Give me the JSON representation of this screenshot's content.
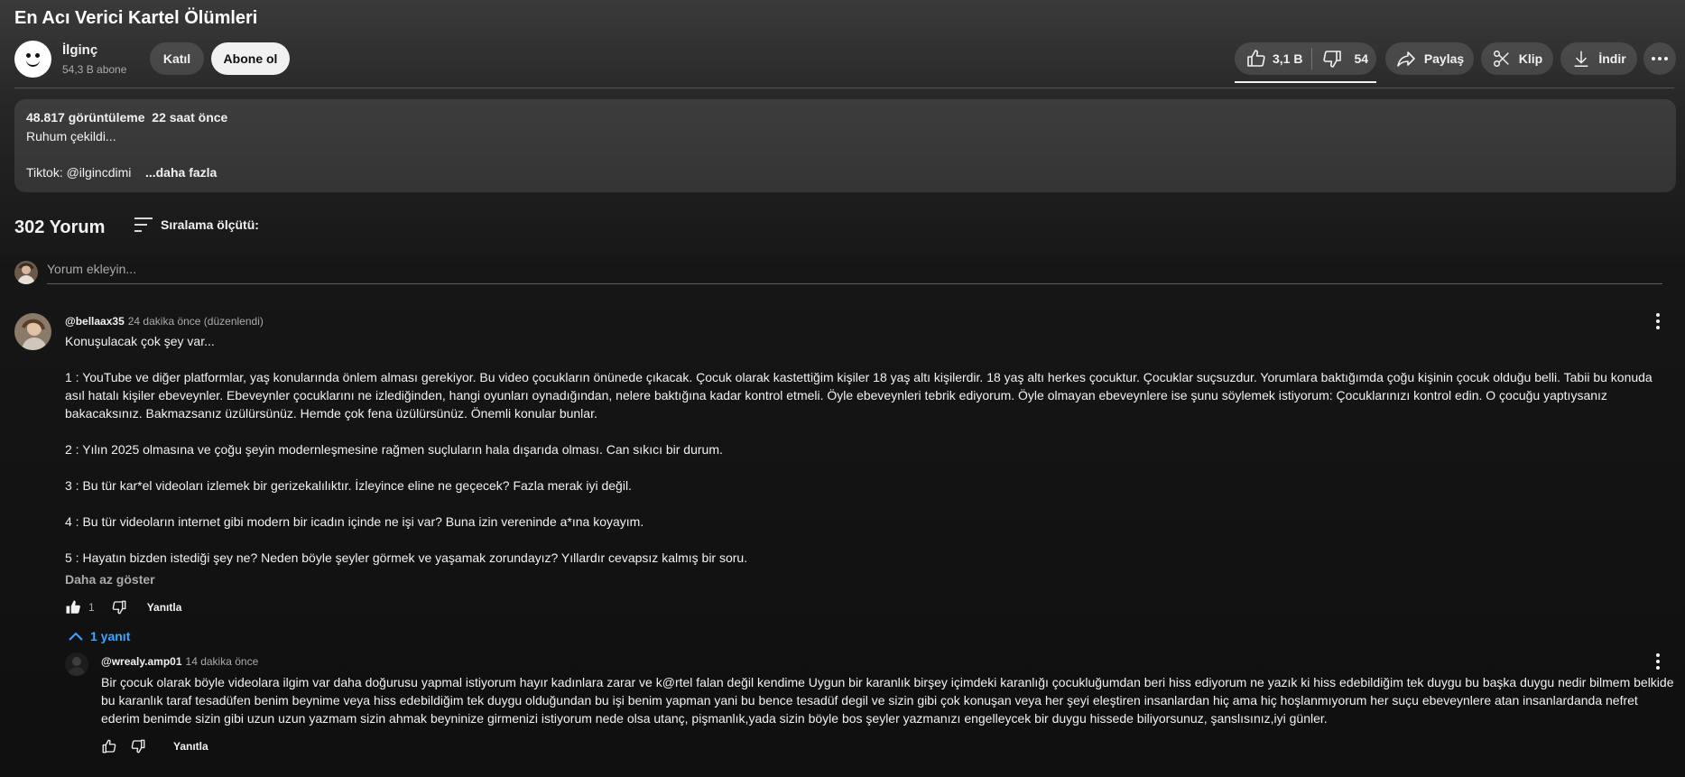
{
  "video": {
    "title": "En Acı Verici Kartel Ölümleri"
  },
  "channel": {
    "name": "İlginç",
    "subscribers": "54,3 B abone",
    "join_label": "Katıl",
    "subscribe_label": "Abone ol"
  },
  "actions": {
    "likes": "3,1 B",
    "dislikes": "54",
    "share": "Paylaş",
    "clip": "Klip",
    "download": "İndir",
    "more_icon": "more-horizontal-icon"
  },
  "description": {
    "views": "48.817 görüntüleme",
    "time": "22 saat önce",
    "line1": "Ruhum çekildi...",
    "tiktok": "Tiktok: @ilgincdimi",
    "more": "...daha fazla"
  },
  "comments": {
    "count": "302 Yorum",
    "sort_label": "Sıralama ölçütü:",
    "add_placeholder": "Yorum ekleyin...",
    "items": [
      {
        "author": "@bellaax35",
        "time": "24 dakika önce (düzenlendi)",
        "text": "Konuşulacak çok şey var...\n\n1 : YouTube ve diğer platformlar, yaş konularında önlem alması gerekiyor. Bu video çocukların önünede çıkacak. Çocuk olarak kastettiğim kişiler 18 yaş altı kişilerdir. 18 yaş altı herkes çocuktur. Çocuklar suçsuzdur. Yorumlara baktığımda çoğu kişinin çocuk olduğu belli. Tabii bu konuda asıl hatalı kişiler ebeveynler. Ebeveynler çocuklarını ne izlediğinden, hangi oyunları oynadığından, nelere baktığına kadar kontrol etmeli. Öyle ebeveynleri tebrik ediyorum. Öyle olmayan ebeveynlere ise şunu söylemek istiyorum: Çocuklarınızı kontrol edin. O çocuğu yaptıysanız bakacaksınız. Bakmazsanız üzülürsünüz. Hemde çok fena üzülürsünüz. Önemli konular bunlar.\n\n2 : Yılın 2025 olmasına ve çoğu şeyin modernleşmesine rağmen suçluların hala dışarıda olması. Can sıkıcı bir durum.\n\n3 : Bu tür kar*el videoları izlemek bir gerizekalılıktır. İzleyince eline ne geçecek? Fazla merak iyi değil.\n\n4 : Bu tür videoların internet gibi modern bir icadın içinde ne işi var? Buna izin vereninde a*ına koyayım.\n\n5 : Hayatın bizden istediği şey ne? Neden böyle şeyler görmek ve yaşamak zorundayız? Yıllardır cevapsız kalmış bir soru.",
        "show_less": "Daha az göster",
        "likes": "1",
        "reply_label": "Yanıtla",
        "replies_toggle": "1 yanıt"
      }
    ],
    "reply": {
      "author": "@wrealy.amp01",
      "time": "14 dakika önce",
      "text": "Bir çocuk olarak böyle videolara ilgim var daha doğurusu yapmal istiyorum hayır kadınlara zarar ve k@rtel falan değil kendime Uygun bir karanlık birşey içimdeki karanlığı çocukluğumdan beri hiss ediyorum ne yazık ki hiss edebildiğim tek duygu bu başka duygu nedir bilmem belkide bu karanlık taraf tesadüfen benim beynime veya hiss edebildiğim tek duygu olduğundan bu işi benim yapman yani bu bence tesadüf degil ve sizin gibi çok konuşan veya her şeyi eleştiren insanlardan hiç ama hiç hoşlanmıyorum her suçu ebeveynlere atan insanlardanda nefret ederim benimde sizin gibi uzun uzun yazmam sizin ahmak beyninize girmenizi istiyorum nede olsa utanç, pişmanlık,yada sizin böyle bos şeyler yazmanızı engelleycek bir duygu hissede biliyorsunuz, şanslısınız,iyi günler.",
      "reply_label": "Yanıtla"
    }
  }
}
